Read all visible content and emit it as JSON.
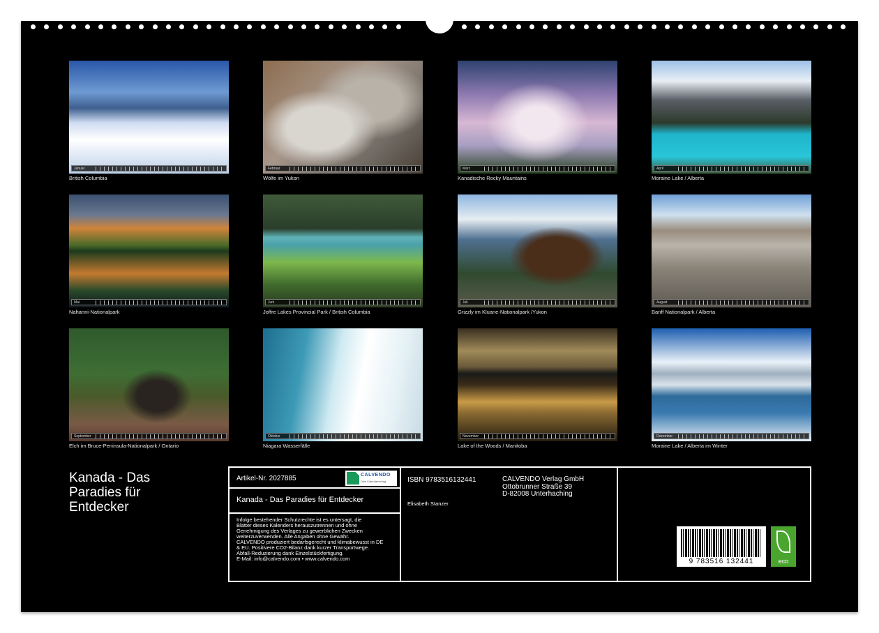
{
  "calendar": {
    "title_lines": [
      "Kanada - Das",
      "Paradies für",
      "Entdecker"
    ]
  },
  "photos": [
    {
      "month": "Januar",
      "caption": "British Columbia",
      "scene": "snow-forest"
    },
    {
      "month": "Februar",
      "caption": "Wölfe im Yukon",
      "scene": "wolves"
    },
    {
      "month": "März",
      "caption": "Kanadische Rocky Mauntains",
      "scene": "cloudy-peak"
    },
    {
      "month": "April",
      "caption": "Moraine Lake / Alberta",
      "scene": "turquoise-lake"
    },
    {
      "month": "Mai",
      "caption": "Nahanni-Nationalpark",
      "scene": "mountain-reflection"
    },
    {
      "month": "Juni",
      "caption": "Joffre Lakes Provincial Park / British Columbia",
      "scene": "green-lake"
    },
    {
      "month": "Juli",
      "caption": "Grizzly im Kluane-Nationalpark /Yukon",
      "scene": "grizzly-bear"
    },
    {
      "month": "August",
      "caption": "Banff Nationalpark / Alberta",
      "scene": "rocky-shore"
    },
    {
      "month": "September",
      "caption": "Elch im Bruce-Peninsula-Nationalpark / Ontario",
      "scene": "moose"
    },
    {
      "month": "Oktober",
      "caption": "Niagara Wasserfälle",
      "scene": "waterfall"
    },
    {
      "month": "November",
      "caption": "Lake of the Woods / Manitoba",
      "scene": "sunset-lake"
    },
    {
      "month": "Dezember",
      "caption": "Moraine Lake / Alberta im Winter",
      "scene": "winter-lake"
    }
  ],
  "info": {
    "article": "Artikel-Nr. 2027885",
    "logo_word": "CALVENDO",
    "logo_sub": "Dein Kalenderverlag",
    "product_title": "Kanada - Das Paradies für Entdecker",
    "legal_lines": [
      "Infolge bestehender Schutzrechte ist es untersagt, die",
      "Blätter dieses Kalenders herauszutrennen und ohne",
      "Genehmigung des Verlages zu gewerblichen Zwecken",
      "weiterzuverwenden. Alle Angaben ohne Gewähr.",
      "CALVENDO produziert bedarfsgerecht und klimabewusst in DE",
      "& EU. Positivere CO2-Bilanz dank kurzer Transportwege.",
      "Abfall-Reduzierung dank Einzelstückfertigung.",
      "E-Mail: info@calvendo.com • www.calvendo.com"
    ],
    "isbn": "ISBN 9783516132441",
    "author": "Elisabeth Stanzer",
    "publisher_lines": [
      "CALVENDO Verlag GmbH",
      "Ottobrunner Straße 39",
      "D-82008 Unterhaching"
    ],
    "barcode_number": "9 783516 132441",
    "eco_label": "eco"
  }
}
